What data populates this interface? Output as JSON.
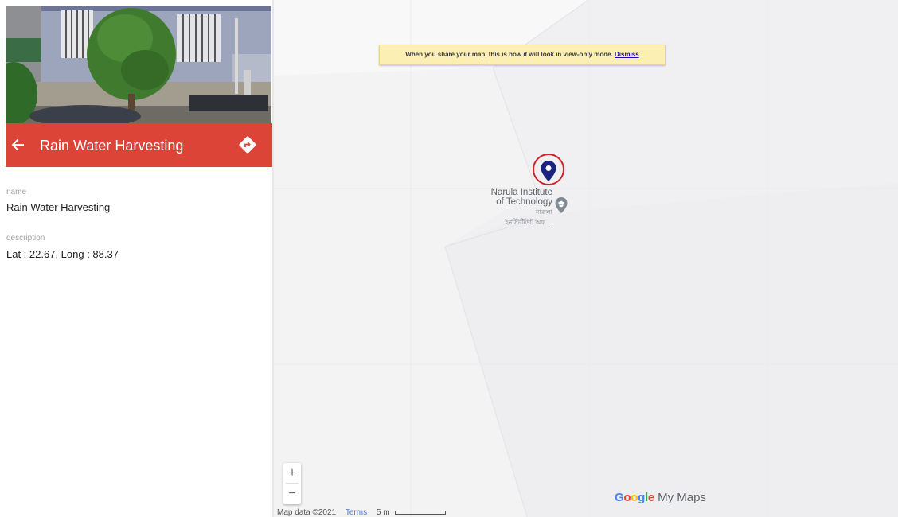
{
  "panel": {
    "photo_alt": "building with tree",
    "title": "Rain Water Harvesting",
    "back_icon": "arrow-left-icon",
    "directions_icon": "directions-icon",
    "fields": [
      {
        "label": "name",
        "value": "Rain Water Harvesting"
      },
      {
        "label": "description",
        "value": "Lat : 22.67, Long : 88.37"
      }
    ],
    "header_color": "#db4437"
  },
  "map": {
    "notice_text": "When you share your map, this is how it will look in view-only mode.",
    "notice_link": "Dismiss",
    "poi_name_line1": "Narula Institute",
    "poi_name_line2": "of Technology",
    "poi_subtitle_line1": "নারুলা",
    "poi_subtitle_line2": "ইনস্টিটিউট অফ ...",
    "marker_icon": "map-pin-icon",
    "poi_icon": "education-place-icon",
    "zoom_in": "+",
    "zoom_out": "−",
    "brand_google": "Google",
    "brand_product": "My Maps",
    "attribution_text": "Map data ©2021",
    "terms_link": "Terms",
    "scale_label": "5 m",
    "marker_color": "#1a237e",
    "highlight_color": "#d2232a"
  }
}
